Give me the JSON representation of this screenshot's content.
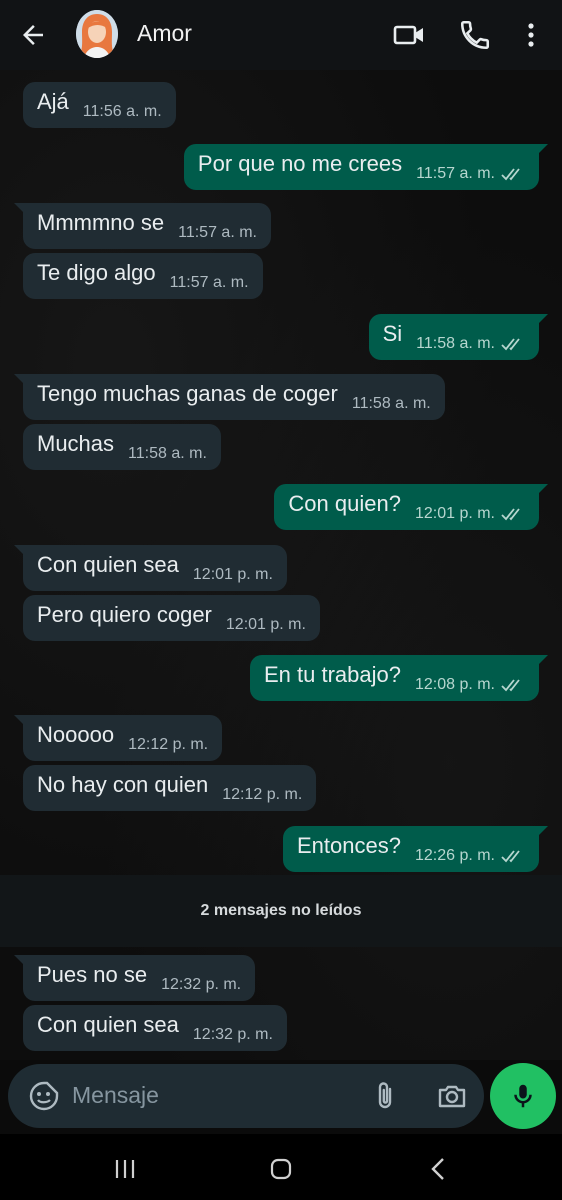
{
  "header": {
    "contact_name": "Amor"
  },
  "messages": [
    {
      "dir": "in",
      "text": "Ajá",
      "time": "11:56 a. m."
    },
    {
      "dir": "out",
      "text": "Por que no me crees",
      "time": "11:57 a. m."
    },
    {
      "dir": "in",
      "text": "Mmmmno se",
      "time": "11:57 a. m."
    },
    {
      "dir": "in",
      "text": "Te digo algo",
      "time": "11:57 a. m."
    },
    {
      "dir": "out",
      "text": "Si",
      "time": "11:58 a. m."
    },
    {
      "dir": "in",
      "text": "Tengo muchas ganas de coger",
      "time": "11:58 a. m."
    },
    {
      "dir": "in",
      "text": "Muchas",
      "time": "11:58 a. m."
    },
    {
      "dir": "out",
      "text": "Con quien?",
      "time": "12:01 p. m."
    },
    {
      "dir": "in",
      "text": "Con quien sea",
      "time": "12:01 p. m."
    },
    {
      "dir": "in",
      "text": "Pero quiero coger",
      "time": "12:01 p. m."
    },
    {
      "dir": "out",
      "text": "En tu trabajo?",
      "time": "12:08 p. m."
    },
    {
      "dir": "in",
      "text": "Nooooo",
      "time": "12:12 p. m."
    },
    {
      "dir": "in",
      "text": "No hay con quien",
      "time": "12:12 p. m."
    },
    {
      "dir": "out",
      "text": "Entonces?",
      "time": "12:26 p. m."
    },
    {
      "dir": "in",
      "text": "Pues no se",
      "time": "12:32 p. m."
    },
    {
      "dir": "in",
      "text": "Con quien sea",
      "time": "12:32 p. m."
    }
  ],
  "unread_banner": "2 mensajes no leídos",
  "composer": {
    "placeholder": "Mensaje"
  },
  "colors": {
    "incoming": "#202c33",
    "outgoing": "#005c4b",
    "accent": "#21c063"
  },
  "icons": [
    "back-arrow-icon",
    "video-call-icon",
    "phone-icon",
    "more-options-icon",
    "double-check-icon",
    "emoji-icon",
    "attach-icon",
    "camera-icon",
    "mic-icon"
  ]
}
